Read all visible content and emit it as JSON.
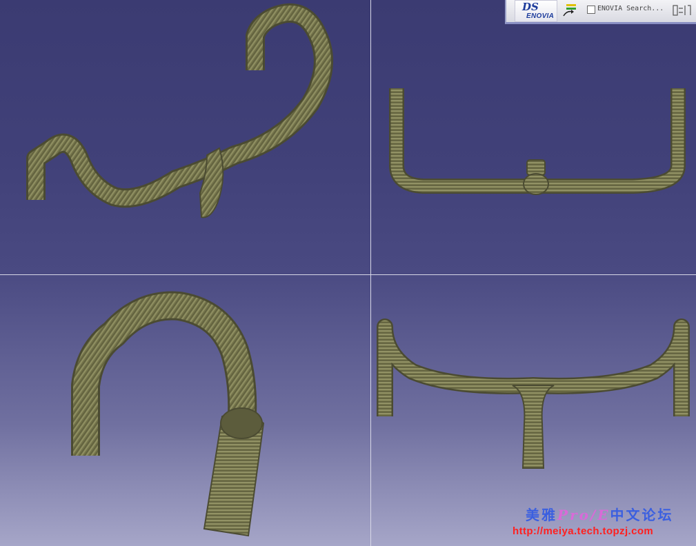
{
  "toolbar": {
    "brand_mark": "DS",
    "brand_name": "ENOVIA",
    "search_label": "ENOVIA Search..."
  },
  "viewports": [
    {
      "name": "isometric-view",
      "object": "handlebar"
    },
    {
      "name": "top-view",
      "object": "handlebar"
    },
    {
      "name": "side-view",
      "object": "handlebar"
    },
    {
      "name": "front-view",
      "object": "handlebar"
    }
  ],
  "watermark": {
    "title_prefix": "美雅",
    "title_mid": "Pro/E",
    "title_suffix": "中文论坛",
    "url": "http://meiya.tech.topzj.com"
  },
  "colors": {
    "background": "#3f3f77",
    "model": "#6b6b47",
    "model_highlight": "#9a9a6c",
    "watermark_title": "#3a5fe0",
    "watermark_url": "#ff2020"
  }
}
